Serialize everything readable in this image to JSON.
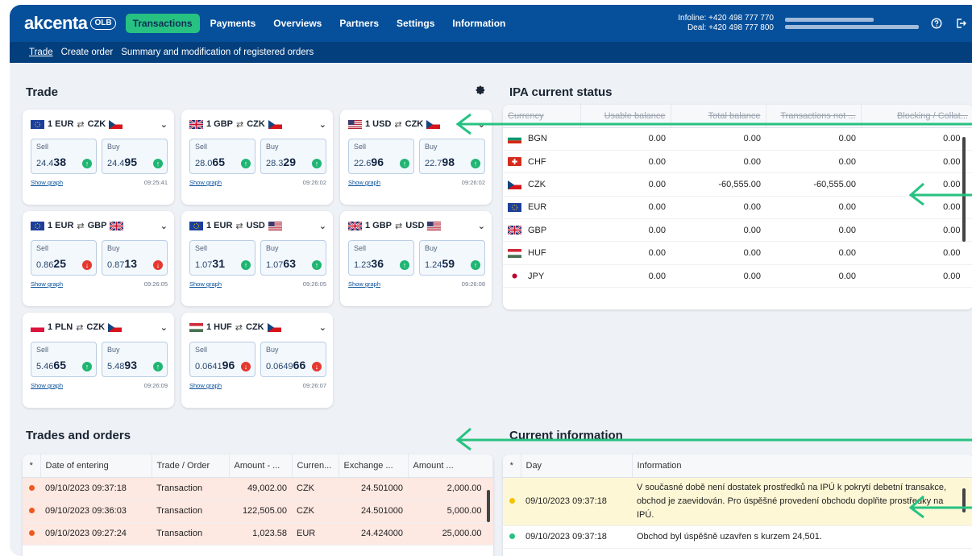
{
  "header": {
    "logo_text": "akcenta",
    "logo_badge": "OLB",
    "nav": [
      {
        "label": "Transactions",
        "active": true
      },
      {
        "label": "Payments"
      },
      {
        "label": "Overviews"
      },
      {
        "label": "Partners"
      },
      {
        "label": "Settings"
      },
      {
        "label": "Information"
      }
    ],
    "infoline": "Infoline: +420 498 777 770",
    "deal": "Deal: +420 498 777 800",
    "help_icon": "help-circle-icon",
    "logout_icon": "logout-icon"
  },
  "subnav": [
    {
      "label": "Trade",
      "active": true
    },
    {
      "label": "Create order"
    },
    {
      "label": "Summary and modification of registered orders"
    }
  ],
  "trade": {
    "title": "Trade",
    "settings_icon": "gear-icon",
    "sell_label": "Sell",
    "buy_label": "Buy",
    "graph_label": "Show graph",
    "cards": [
      {
        "pair_from": "1 EUR",
        "pair_to": "CZK",
        "flag_from": "eu",
        "flag_to": "cz",
        "sell_pre": "24.4",
        "sell_big": "38",
        "sell_dir": "up",
        "buy_pre": "24.4",
        "buy_big": "95",
        "buy_dir": "up",
        "time": "09:25:41"
      },
      {
        "pair_from": "1 GBP",
        "pair_to": "CZK",
        "flag_from": "gb",
        "flag_to": "cz",
        "sell_pre": "28.0",
        "sell_big": "65",
        "sell_dir": "up",
        "buy_pre": "28.3",
        "buy_big": "29",
        "buy_dir": "up",
        "time": "09:26:02"
      },
      {
        "pair_from": "1 USD",
        "pair_to": "CZK",
        "flag_from": "us",
        "flag_to": "cz",
        "sell_pre": "22.6",
        "sell_big": "96",
        "sell_dir": "up",
        "buy_pre": "22.7",
        "buy_big": "98",
        "buy_dir": "up",
        "time": "09:26:02"
      },
      {
        "pair_from": "1 EUR",
        "pair_to": "GBP",
        "flag_from": "eu",
        "flag_to": "gb",
        "sell_pre": "0.86",
        "sell_big": "25",
        "sell_dir": "down",
        "buy_pre": "0.87",
        "buy_big": "13",
        "buy_dir": "down",
        "time": "09:26:05"
      },
      {
        "pair_from": "1 EUR",
        "pair_to": "USD",
        "flag_from": "eu",
        "flag_to": "us",
        "sell_pre": "1.07",
        "sell_big": "31",
        "sell_dir": "up",
        "buy_pre": "1.07",
        "buy_big": "63",
        "buy_dir": "up",
        "time": "09:26:05"
      },
      {
        "pair_from": "1 GBP",
        "pair_to": "USD",
        "flag_from": "gb",
        "flag_to": "us",
        "sell_pre": "1.23",
        "sell_big": "36",
        "sell_dir": "up",
        "buy_pre": "1.24",
        "buy_big": "59",
        "buy_dir": "up",
        "time": "09:26:08"
      },
      {
        "pair_from": "1 PLN",
        "pair_to": "CZK",
        "flag_from": "pl",
        "flag_to": "cz",
        "sell_pre": "5.46",
        "sell_big": "65",
        "sell_dir": "up",
        "buy_pre": "5.48",
        "buy_big": "93",
        "buy_dir": "up",
        "time": "09:26:09"
      },
      {
        "pair_from": "1 HUF",
        "pair_to": "CZK",
        "flag_from": "hu",
        "flag_to": "cz",
        "sell_pre": "0.0641",
        "sell_big": "96",
        "sell_dir": "down",
        "buy_pre": "0.0649",
        "buy_big": "66",
        "buy_dir": "down",
        "time": "09:26:07"
      }
    ]
  },
  "ipa": {
    "title": "IPA current status",
    "columns": [
      "Currency",
      "Usable balance",
      "Total balance",
      "Transactions not ...",
      "Blocking / Collat..."
    ],
    "rows": [
      {
        "flag": "bg",
        "currency": "BGN",
        "usable": "0.00",
        "total": "0.00",
        "not_settled": "0.00",
        "blocking": "0.00"
      },
      {
        "flag": "ch",
        "currency": "CHF",
        "usable": "0.00",
        "total": "0.00",
        "not_settled": "0.00",
        "blocking": "0.00"
      },
      {
        "flag": "cz",
        "currency": "CZK",
        "usable": "0.00",
        "total": "-60,555.00",
        "not_settled": "-60,555.00",
        "blocking": "0.00"
      },
      {
        "flag": "eu",
        "currency": "EUR",
        "usable": "0.00",
        "total": "0.00",
        "not_settled": "0.00",
        "blocking": "0.00"
      },
      {
        "flag": "gb",
        "currency": "GBP",
        "usable": "0.00",
        "total": "0.00",
        "not_settled": "0.00",
        "blocking": "0.00"
      },
      {
        "flag": "hu",
        "currency": "HUF",
        "usable": "0.00",
        "total": "0.00",
        "not_settled": "0.00",
        "blocking": "0.00"
      },
      {
        "flag": "jp",
        "currency": "JPY",
        "usable": "0.00",
        "total": "0.00",
        "not_settled": "0.00",
        "blocking": "0.00"
      }
    ]
  },
  "trades": {
    "title": "Trades and orders",
    "columns": [
      "*",
      "Date of entering",
      "Trade / Order",
      "Amount - ...",
      "Curren...",
      "Exchange ...",
      "Amount ..."
    ],
    "rows": [
      {
        "date": "09/10/2023 09:37:18",
        "type": "Transaction",
        "amount": "49,002.00",
        "currency": "CZK",
        "rate": "24.501000",
        "amount2": "2,000.00"
      },
      {
        "date": "09/10/2023 09:36:03",
        "type": "Transaction",
        "amount": "122,505.00",
        "currency": "CZK",
        "rate": "24.501000",
        "amount2": "5,000.00"
      },
      {
        "date": "09/10/2023 09:27:24",
        "type": "Transaction",
        "amount": "1,023.58",
        "currency": "EUR",
        "rate": "24.424000",
        "amount2": "25,000.00"
      }
    ]
  },
  "info": {
    "title": "Current information",
    "columns": [
      "*",
      "Day",
      "Information"
    ],
    "rows": [
      {
        "status": "yellow",
        "day": "09/10/2023 09:37:18",
        "text": "V současné době není dostatek prostředků na IPÚ k pokrytí debetní transakce, obchod je zaevidován. Pro úspěšné provedení obchodu doplňte prostředky na IPÚ."
      },
      {
        "status": "green",
        "day": "09/10/2023 09:37:18",
        "text": "Obchod byl úspěšně uzavřen s kurzem 24,501."
      }
    ]
  },
  "colors": {
    "brand_blue": "#06509b",
    "accent_green": "#27c281",
    "up": "#1fb673",
    "down": "#e5392f",
    "annotation_arrow": "#27c281"
  }
}
